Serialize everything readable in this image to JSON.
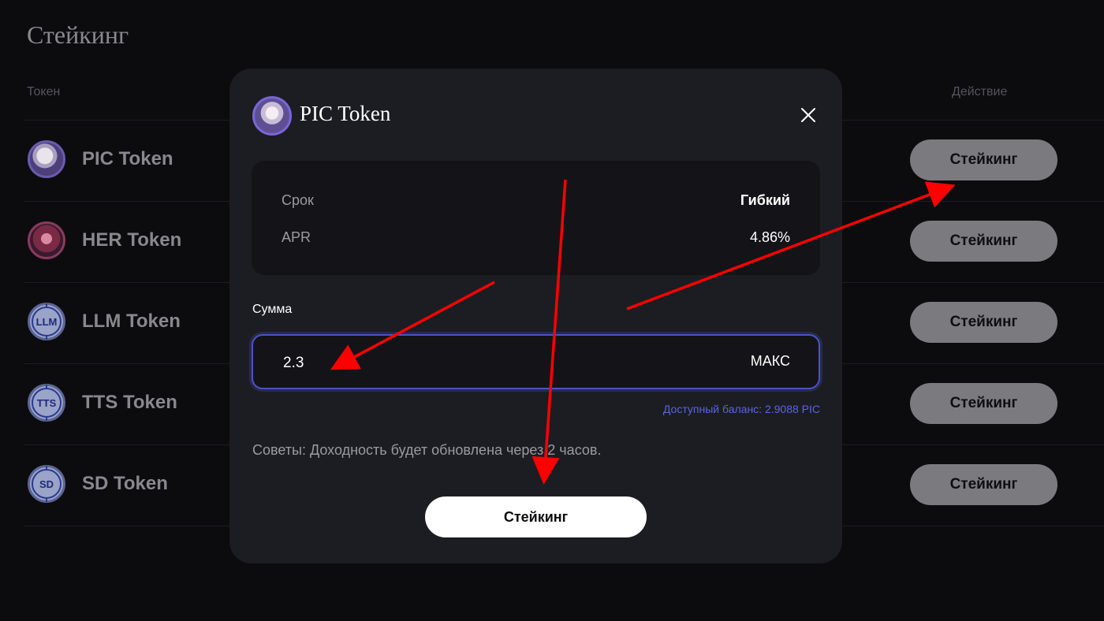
{
  "page": {
    "title": "Стейкинг",
    "columns": {
      "token": "Токен",
      "action": "Действие"
    },
    "rows": [
      {
        "name": "PIC Token",
        "icon": "pic-avatar",
        "button": "Стейкинг"
      },
      {
        "name": "HER Token",
        "icon": "her-avatar",
        "button": "Стейкинг"
      },
      {
        "name": "LLM Token",
        "icon": "llm-coin-icon",
        "icon_text": "LLM",
        "button": "Стейкинг"
      },
      {
        "name": "TTS Token",
        "icon": "tts-coin-icon",
        "icon_text": "TTS",
        "button": "Стейкинг"
      },
      {
        "name": "SD Token",
        "icon": "sd-coin-icon",
        "icon_text": "SD",
        "button": "Стейкинг"
      }
    ]
  },
  "modal": {
    "title": "PIC Token",
    "info": {
      "term_label": "Срок",
      "term_value": "Гибкий",
      "apr_label": "APR",
      "apr_value": "4.86%"
    },
    "amount_label": "Сумма",
    "amount_value": "2.3",
    "max_label": "МАКС",
    "balance_text": "Доступный баланс: 2.9088 PIC",
    "tips_text": "Советы: Доходность будет обновлена через 2 часов.",
    "submit_label": "Стейкинг"
  },
  "colors": {
    "accent": "#4a53c9",
    "balance_text": "#5a63e6",
    "annotation_arrow": "#ff0000"
  }
}
